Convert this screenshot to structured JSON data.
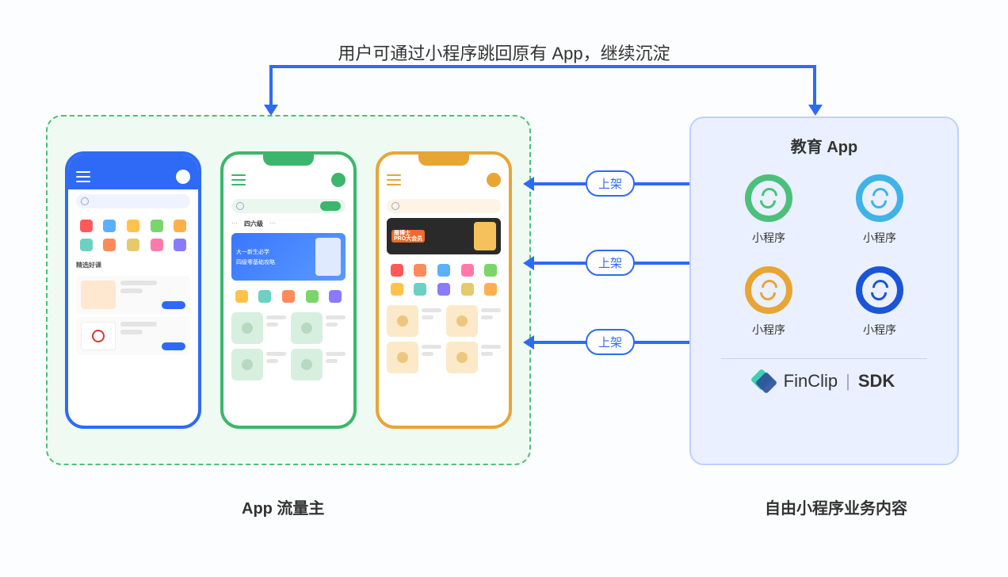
{
  "title": "用户可通过小程序跳回原有 App，继续沉淀",
  "leftPanel": {
    "label": "App 流量主",
    "phones": [
      {
        "color": "blue",
        "sectionTitle": "精选好课"
      },
      {
        "color": "green",
        "tab": "四六级",
        "bannerLine1": "大一新生必学",
        "bannerLine2": "四级零基础攻略"
      },
      {
        "color": "orange",
        "proLine1": "雁博士",
        "proLine2": "PRO大会员"
      }
    ]
  },
  "flows": [
    {
      "label": "上架"
    },
    {
      "label": "上架"
    },
    {
      "label": "上架"
    }
  ],
  "rightPanel": {
    "title": "教育 App",
    "label": "自由小程序业务内容",
    "miniPrograms": [
      {
        "label": "小程序",
        "color": "#4cc07a"
      },
      {
        "label": "小程序",
        "color": "#3fb3e8"
      },
      {
        "label": "小程序",
        "color": "#e8a534"
      },
      {
        "label": "小程序",
        "color": "#1a55d6"
      }
    ],
    "sdk": {
      "brand": "FinClip",
      "tag": "SDK"
    }
  }
}
